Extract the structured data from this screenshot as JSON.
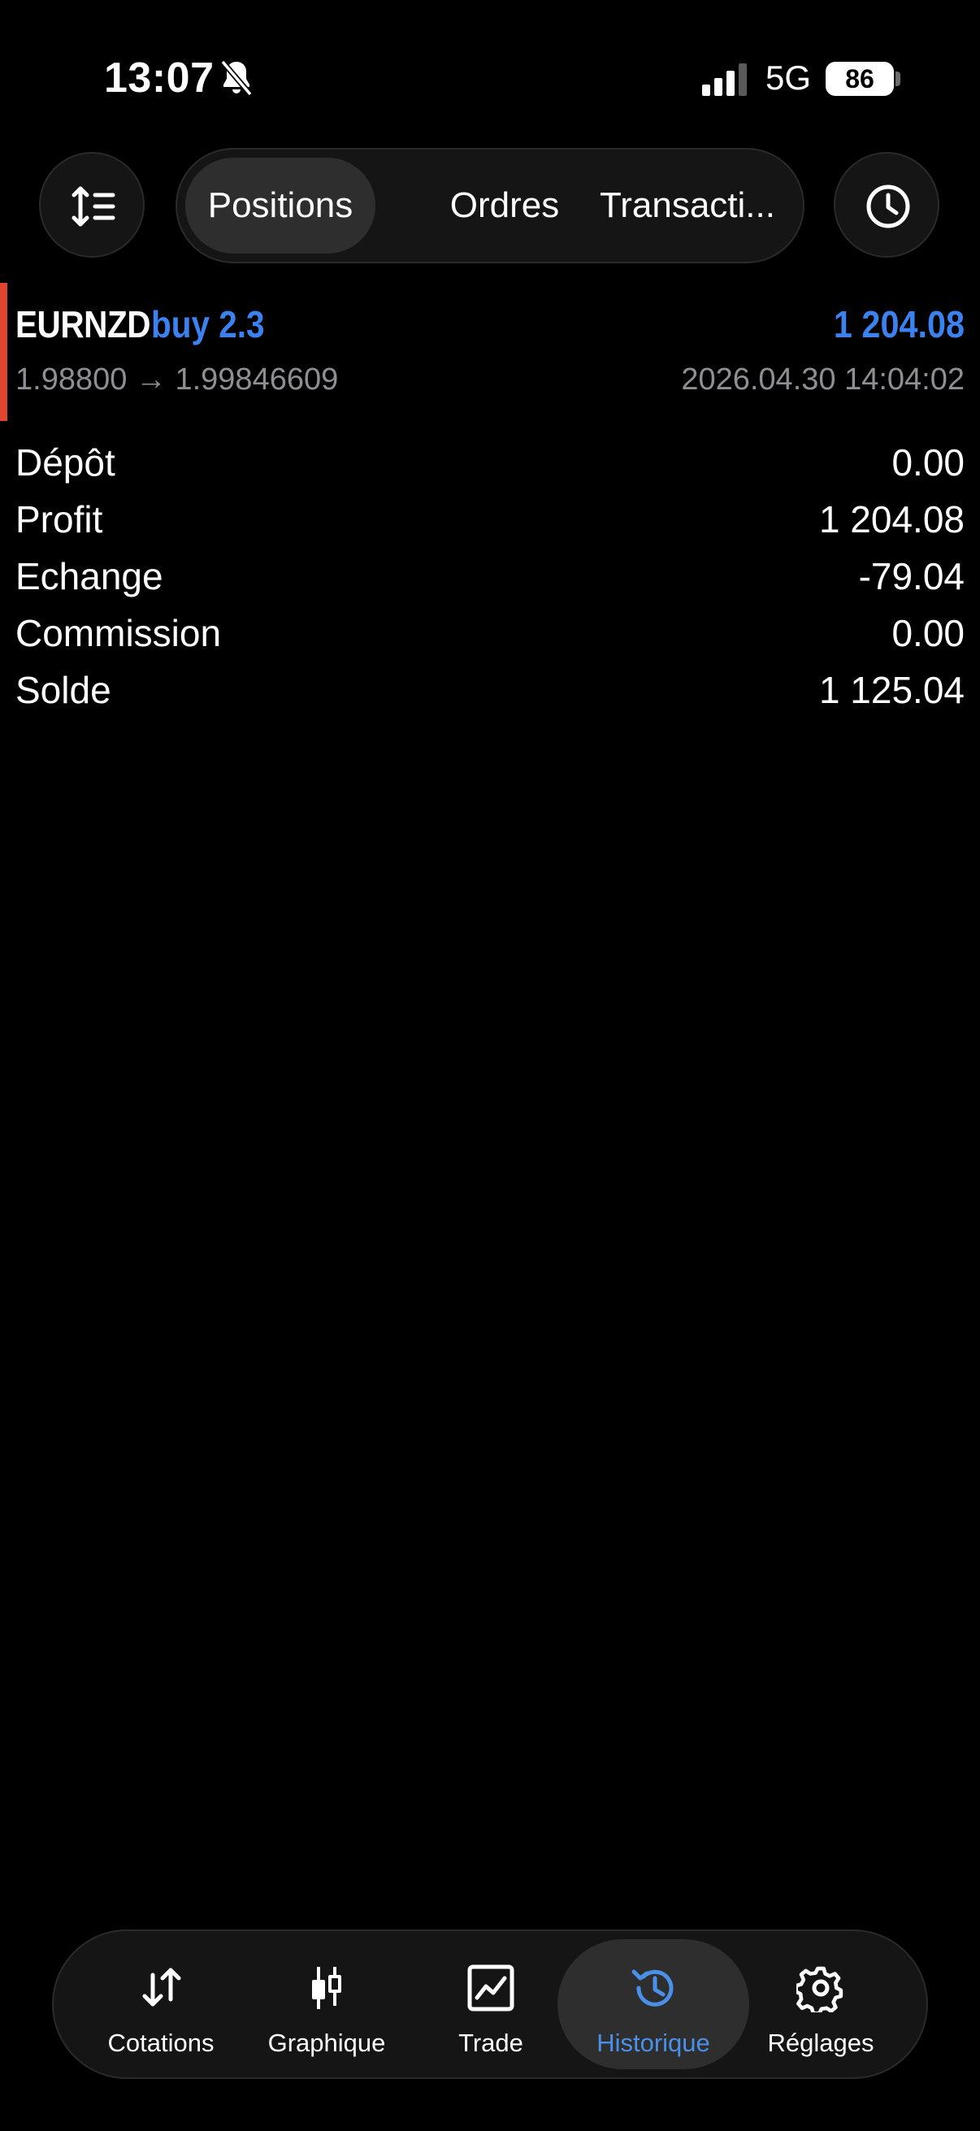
{
  "status_bar": {
    "time": "13:07",
    "network": "5G",
    "battery": "86",
    "silent_icon": "bell-slash-icon",
    "signal_icon": "cellular-signal-icon"
  },
  "toolbar": {
    "sort_icon": "sort-icon",
    "history_period_icon": "clock-icon",
    "tabs": [
      {
        "label": "Positions",
        "active": true
      },
      {
        "label": "Ordres",
        "active": false
      },
      {
        "label": "Transacti...",
        "active": false
      }
    ]
  },
  "position": {
    "symbol": "EURNZD",
    "side": "buy 2.3",
    "profit": "1 204.08",
    "prices": "1.98800 → 1.99846609",
    "time": "2026.04.30 14:04:02",
    "marker_color": "#e0452f",
    "accent_color": "#3b82f0"
  },
  "summary": [
    {
      "label": "Dépôt",
      "value": "0.00"
    },
    {
      "label": "Profit",
      "value": "1 204.08"
    },
    {
      "label": "Echange",
      "value": "-79.04"
    },
    {
      "label": "Commission",
      "value": "0.00"
    },
    {
      "label": "Solde",
      "value": "1 125.04"
    }
  ],
  "bottom_nav": {
    "active_color": "#4a90e8",
    "items": [
      {
        "label": "Cotations",
        "icon": "arrows-up-down-icon",
        "active": false
      },
      {
        "label": "Graphique",
        "icon": "candlestick-icon",
        "active": false
      },
      {
        "label": "Trade",
        "icon": "line-chart-icon",
        "active": false
      },
      {
        "label": "Historique",
        "icon": "history-icon",
        "active": true
      },
      {
        "label": "Réglages",
        "icon": "gear-icon",
        "active": false
      }
    ]
  }
}
